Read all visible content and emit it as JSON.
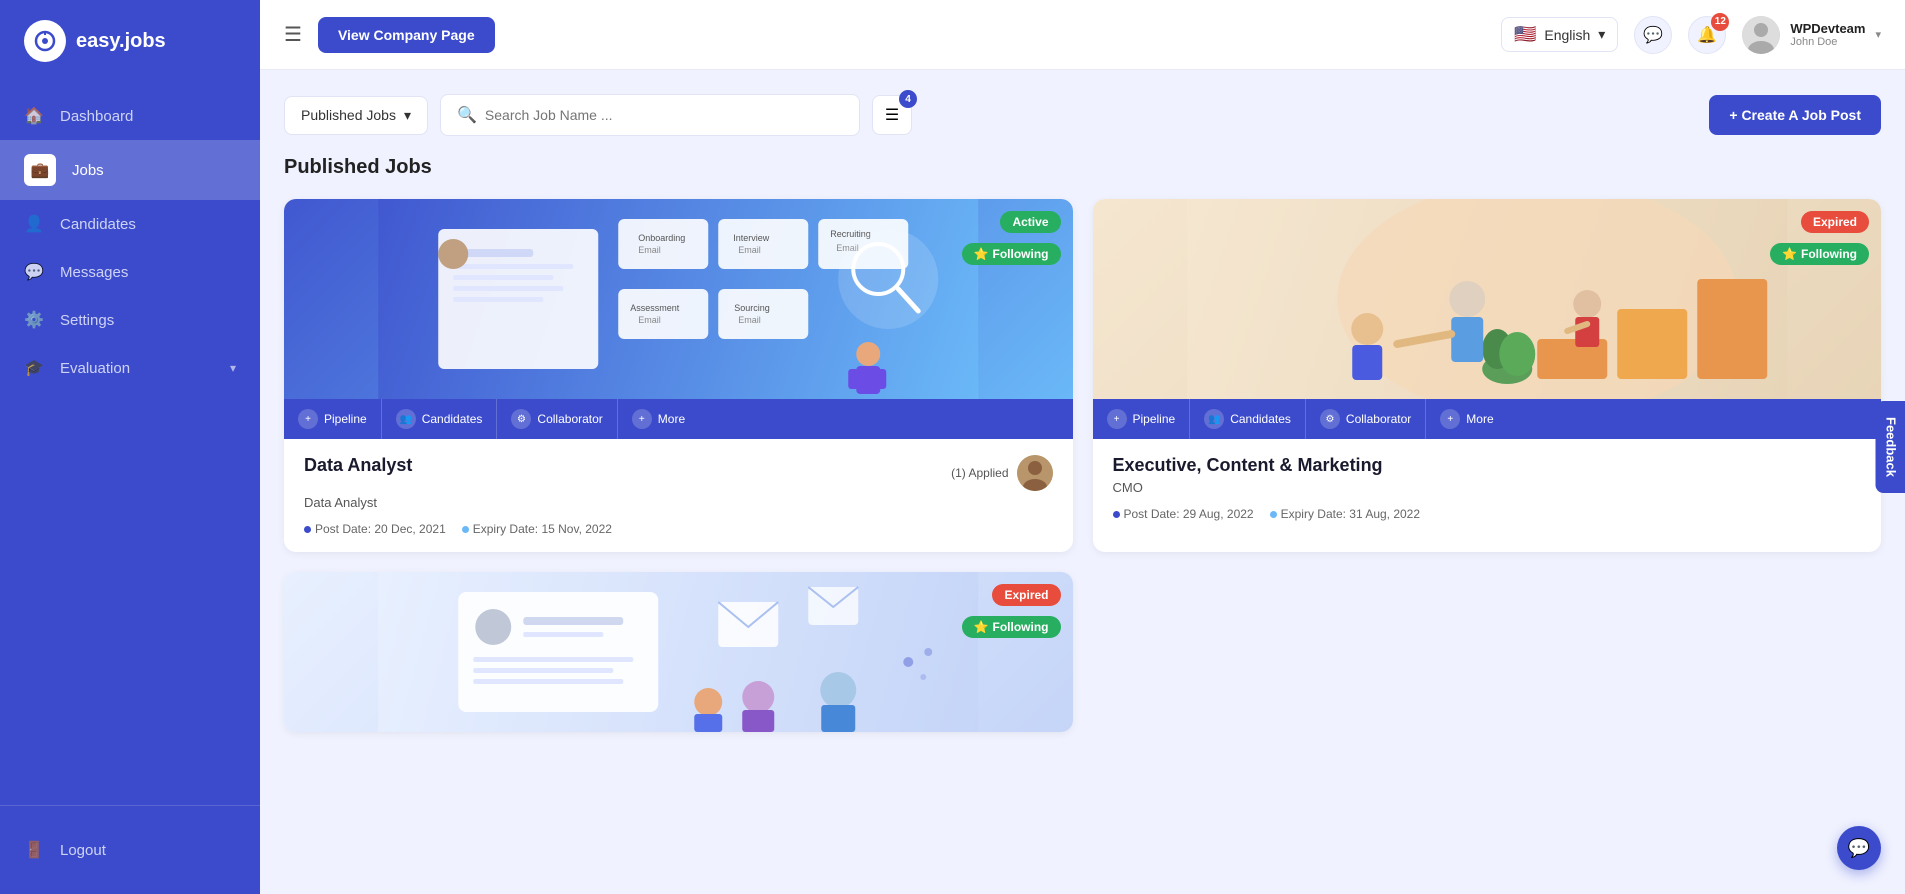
{
  "sidebar": {
    "logo_text": "easy.jobs",
    "logo_symbol": "i",
    "items": [
      {
        "label": "Dashboard",
        "icon": "🏠",
        "active": false,
        "name": "dashboard"
      },
      {
        "label": "Jobs",
        "icon": "💼",
        "active": true,
        "name": "jobs"
      },
      {
        "label": "Candidates",
        "icon": "👤",
        "active": false,
        "name": "candidates"
      },
      {
        "label": "Messages",
        "icon": "💬",
        "active": false,
        "name": "messages"
      },
      {
        "label": "Settings",
        "icon": "⚙️",
        "active": false,
        "name": "settings"
      },
      {
        "label": "Evaluation",
        "icon": "🎓",
        "active": false,
        "name": "evaluation"
      }
    ],
    "logout_label": "Logout",
    "logout_icon": "🚪"
  },
  "header": {
    "menu_icon": "☰",
    "view_company_btn": "View Company Page",
    "language": "English",
    "notification_count": "12",
    "user": {
      "name": "WPDevteam",
      "subtitle": "John Doe"
    }
  },
  "toolbar": {
    "dropdown_label": "Published Jobs",
    "search_placeholder": "Search Job Name ...",
    "filter_badge": "4",
    "create_btn": "+ Create A Job Post"
  },
  "page": {
    "section_title": "Published Jobs"
  },
  "jobs": [
    {
      "id": "job1",
      "status": "Active",
      "status_type": "active",
      "following": true,
      "following_label": "Following",
      "title": "Data Analyst",
      "subtitle": "Data Analyst",
      "applied_count": "(1) Applied",
      "post_date": "Post Date: 20 Dec, 2021",
      "expiry_date": "Expiry Date: 15 Nov, 2022",
      "actions": [
        {
          "label": "Pipeline",
          "icon": "+"
        },
        {
          "label": "Candidates",
          "icon": "👥"
        },
        {
          "label": "Collaborator",
          "icon": "⚙"
        },
        {
          "label": "More",
          "icon": "+"
        }
      ],
      "bg": "blue"
    },
    {
      "id": "job2",
      "status": "Expired",
      "status_type": "expired",
      "following": true,
      "following_label": "Following",
      "title": "Executive, Content & Marketing",
      "subtitle": "CMO",
      "applied_count": "",
      "post_date": "Post Date: 29 Aug, 2022",
      "expiry_date": "Expiry Date: 31 Aug, 2022",
      "actions": [
        {
          "label": "Pipeline",
          "icon": "+"
        },
        {
          "label": "Candidates",
          "icon": "👥"
        },
        {
          "label": "Collaborator",
          "icon": "⚙"
        },
        {
          "label": "More",
          "icon": "+"
        }
      ],
      "bg": "warm"
    },
    {
      "id": "job3",
      "status": "Expired",
      "status_type": "expired",
      "following": true,
      "following_label": "Following",
      "title": "",
      "subtitle": "",
      "applied_count": "",
      "post_date": "",
      "expiry_date": "",
      "actions": [],
      "bg": "light"
    }
  ],
  "feedback": {
    "label": "Feedback"
  },
  "chat": {
    "icon": "💬"
  }
}
